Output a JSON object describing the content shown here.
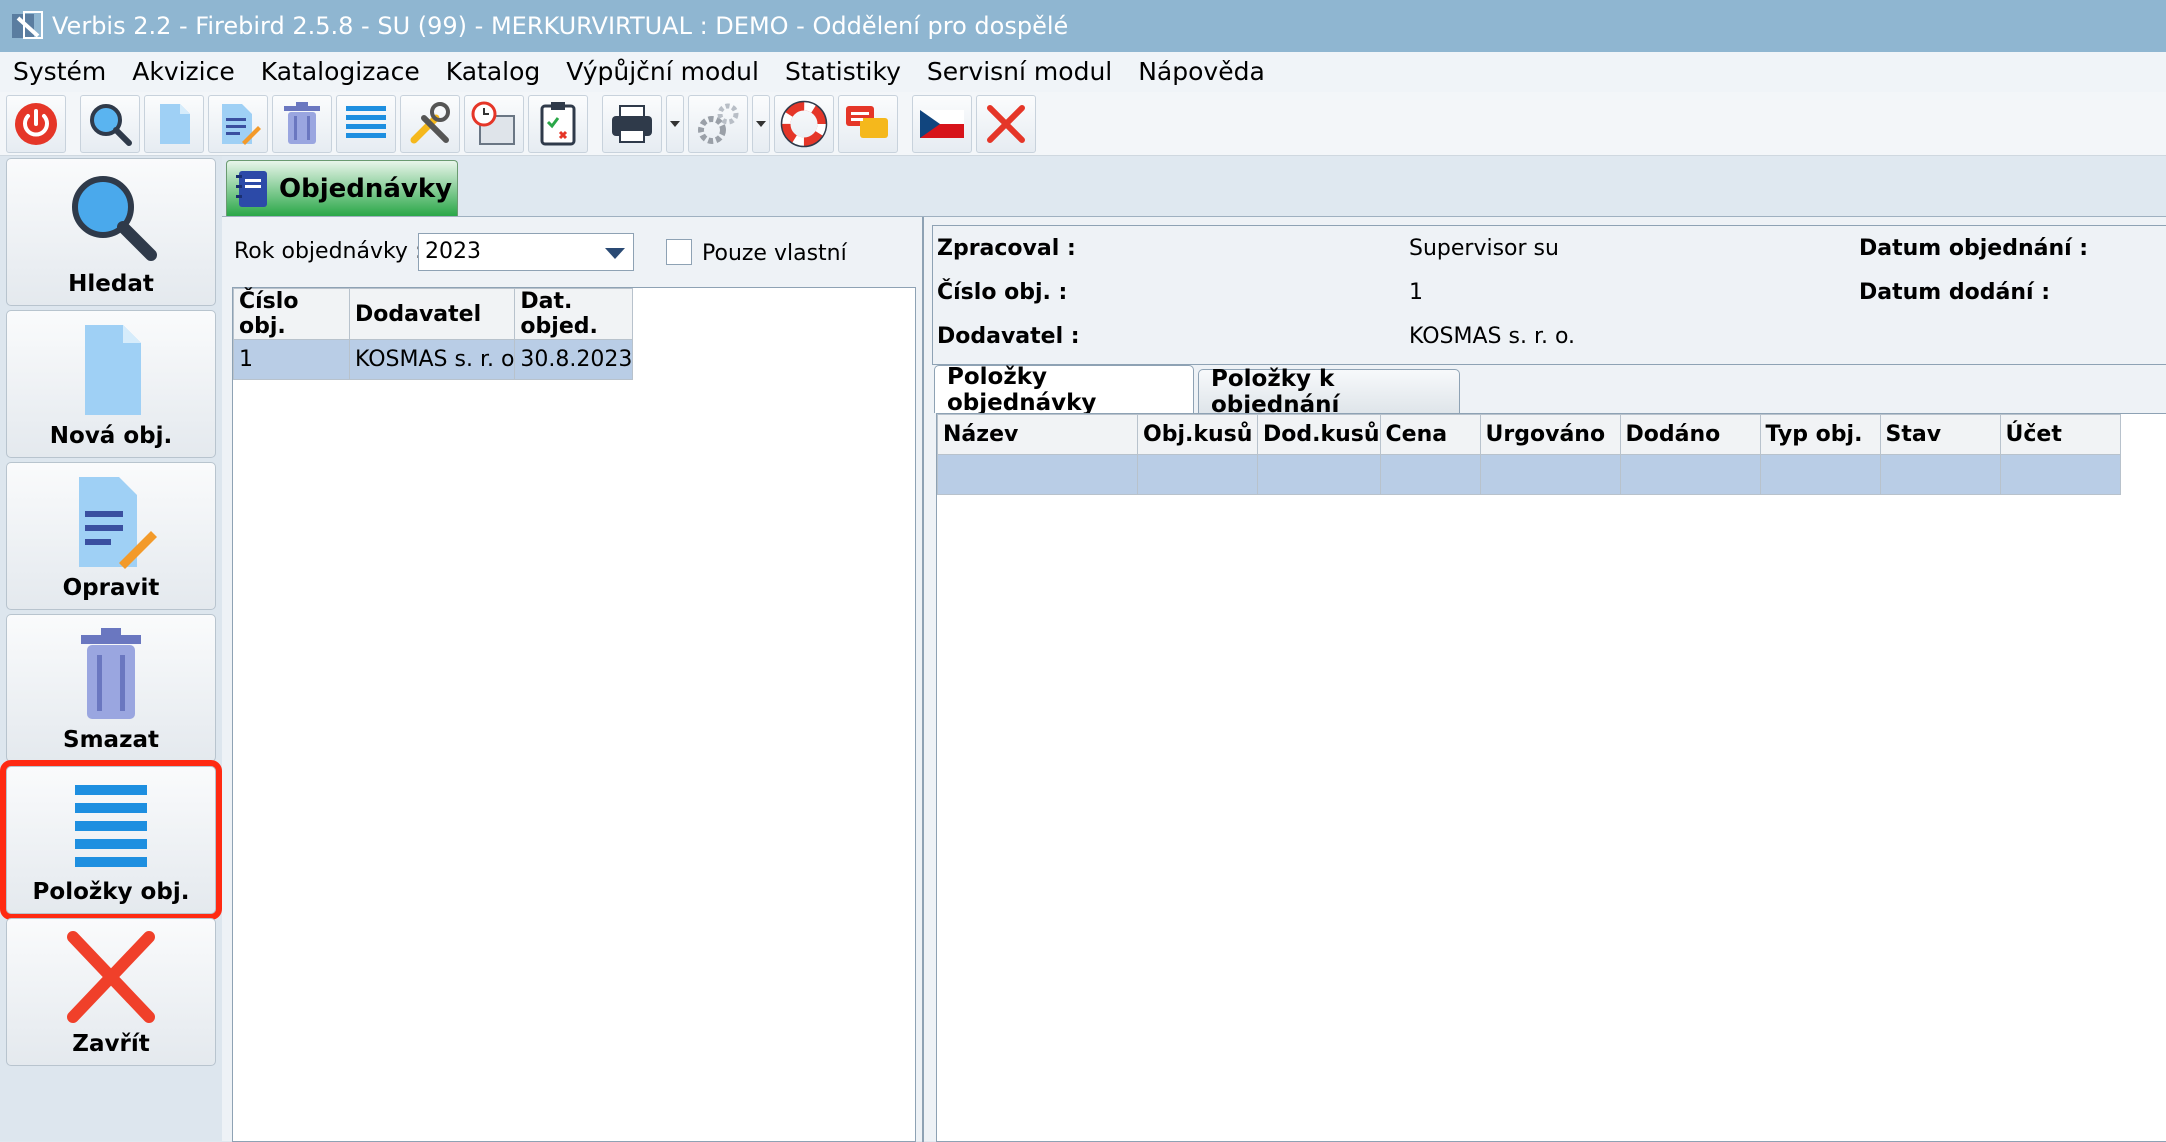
{
  "window": {
    "title": "Verbis 2.2 - Firebird 2.5.8 - SU (99) - MERKURVIRTUAL : DEMO - Oddělení pro dospělé"
  },
  "menu": [
    "Systém",
    "Akvizice",
    "Katalogizace",
    "Katalog",
    "Výpůjční modul",
    "Statistiky",
    "Servisní modul",
    "Nápověda"
  ],
  "toolbar_icons": [
    "power-icon",
    "search-icon",
    "new-document-icon",
    "edit-document-icon",
    "trash-icon",
    "list-icon",
    "tools-icon",
    "calendar-clock-icon",
    "clipboard-icon",
    "printer-icon",
    "gear-icon",
    "lifebuoy-icon",
    "chat-icon",
    "czech-flag-icon",
    "close-icon"
  ],
  "sidebar": {
    "search": "Hledat",
    "new": "Nová obj.",
    "edit": "Opravit",
    "delete": "Smazat",
    "items": "Položky obj.",
    "close": "Zavřít"
  },
  "main_tab": "Objednávky",
  "filter": {
    "year_label": "Rok objednávky :",
    "year_value": "2023",
    "own_only_label": "Pouze vlastní",
    "own_only_checked": false
  },
  "orders_table": {
    "columns": [
      "Číslo obj.",
      "Dodavatel",
      "Dat. objed."
    ],
    "rows": [
      [
        "1",
        "KOSMAS s. r. o",
        "30.8.2023"
      ]
    ]
  },
  "details": {
    "processed_label": "Zpracoval :",
    "processed_value": "Supervisor su",
    "order_no_label": "Číslo obj. :",
    "order_no_value": "1",
    "supplier_label": "Dodavatel :",
    "supplier_value": "KOSMAS s. r. o.",
    "order_date_label": "Datum objednání :",
    "delivery_date_label": "Datum dodání :"
  },
  "subtabs": [
    "Položky objednávky",
    "Položky k objednání"
  ],
  "items_table": {
    "columns": [
      "Název",
      "Obj.kusů",
      "Dod.kusů",
      "Cena",
      "Urgováno",
      "Dodáno",
      "Typ obj.",
      "Stav",
      "Účet"
    ]
  },
  "colors": {
    "highlight": "#ff2a12",
    "selection": "#b9cde6",
    "tab_green": "#2aa748",
    "titlebar": "#8fb6d1"
  }
}
